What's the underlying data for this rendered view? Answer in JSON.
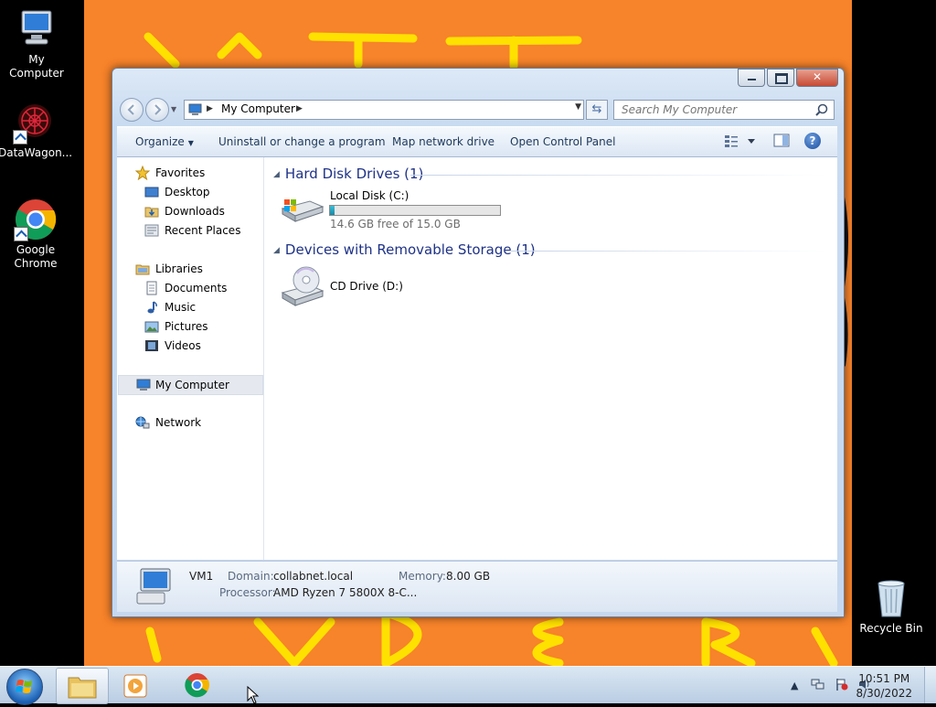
{
  "desktop": {
    "icons": [
      {
        "label": "My Computer",
        "icon": "computer-icon"
      },
      {
        "label": "DataWagon...",
        "icon": "datawagon-icon"
      },
      {
        "label": "Google Chrome",
        "icon": "chrome-icon"
      },
      {
        "label": "Recycle Bin",
        "icon": "recycle-bin-icon"
      }
    ]
  },
  "window": {
    "address": {
      "breadcrumb": "My Computer"
    },
    "search": {
      "placeholder": "Search My Computer"
    },
    "commands": {
      "organize": "Organize",
      "uninstall": "Uninstall or change a program",
      "map_drive": "Map network drive",
      "control_panel": "Open Control Panel"
    },
    "nav": {
      "favorites": "Favorites",
      "desktop": "Desktop",
      "downloads": "Downloads",
      "recent": "Recent Places",
      "libraries": "Libraries",
      "documents": "Documents",
      "music": "Music",
      "pictures": "Pictures",
      "videos": "Videos",
      "my_computer": "My Computer",
      "network": "Network"
    },
    "groups": {
      "hdd": {
        "header": "Hard Disk Drives (1)",
        "drive_name": "Local Disk (C:)",
        "free_text": "14.6 GB free of 15.0 GB",
        "used_fraction": 0.027
      },
      "removable": {
        "header": "Devices with Removable Storage (1)",
        "drive_name": "CD Drive (D:)"
      }
    },
    "details": {
      "name": "VM1",
      "domain_label": "Domain:",
      "domain_value": "collabnet.local",
      "memory_label": "Memory:",
      "memory_value": "8.00 GB",
      "processor_label": "Processor:",
      "processor_value": "AMD Ryzen 7 5800X 8-C..."
    }
  },
  "taskbar": {
    "time": "10:51 PM",
    "date": "8/30/2022"
  },
  "colors": {
    "wallpaper": "#f7832a",
    "scribble": "#ffe100",
    "group_header": "#1e3287"
  }
}
